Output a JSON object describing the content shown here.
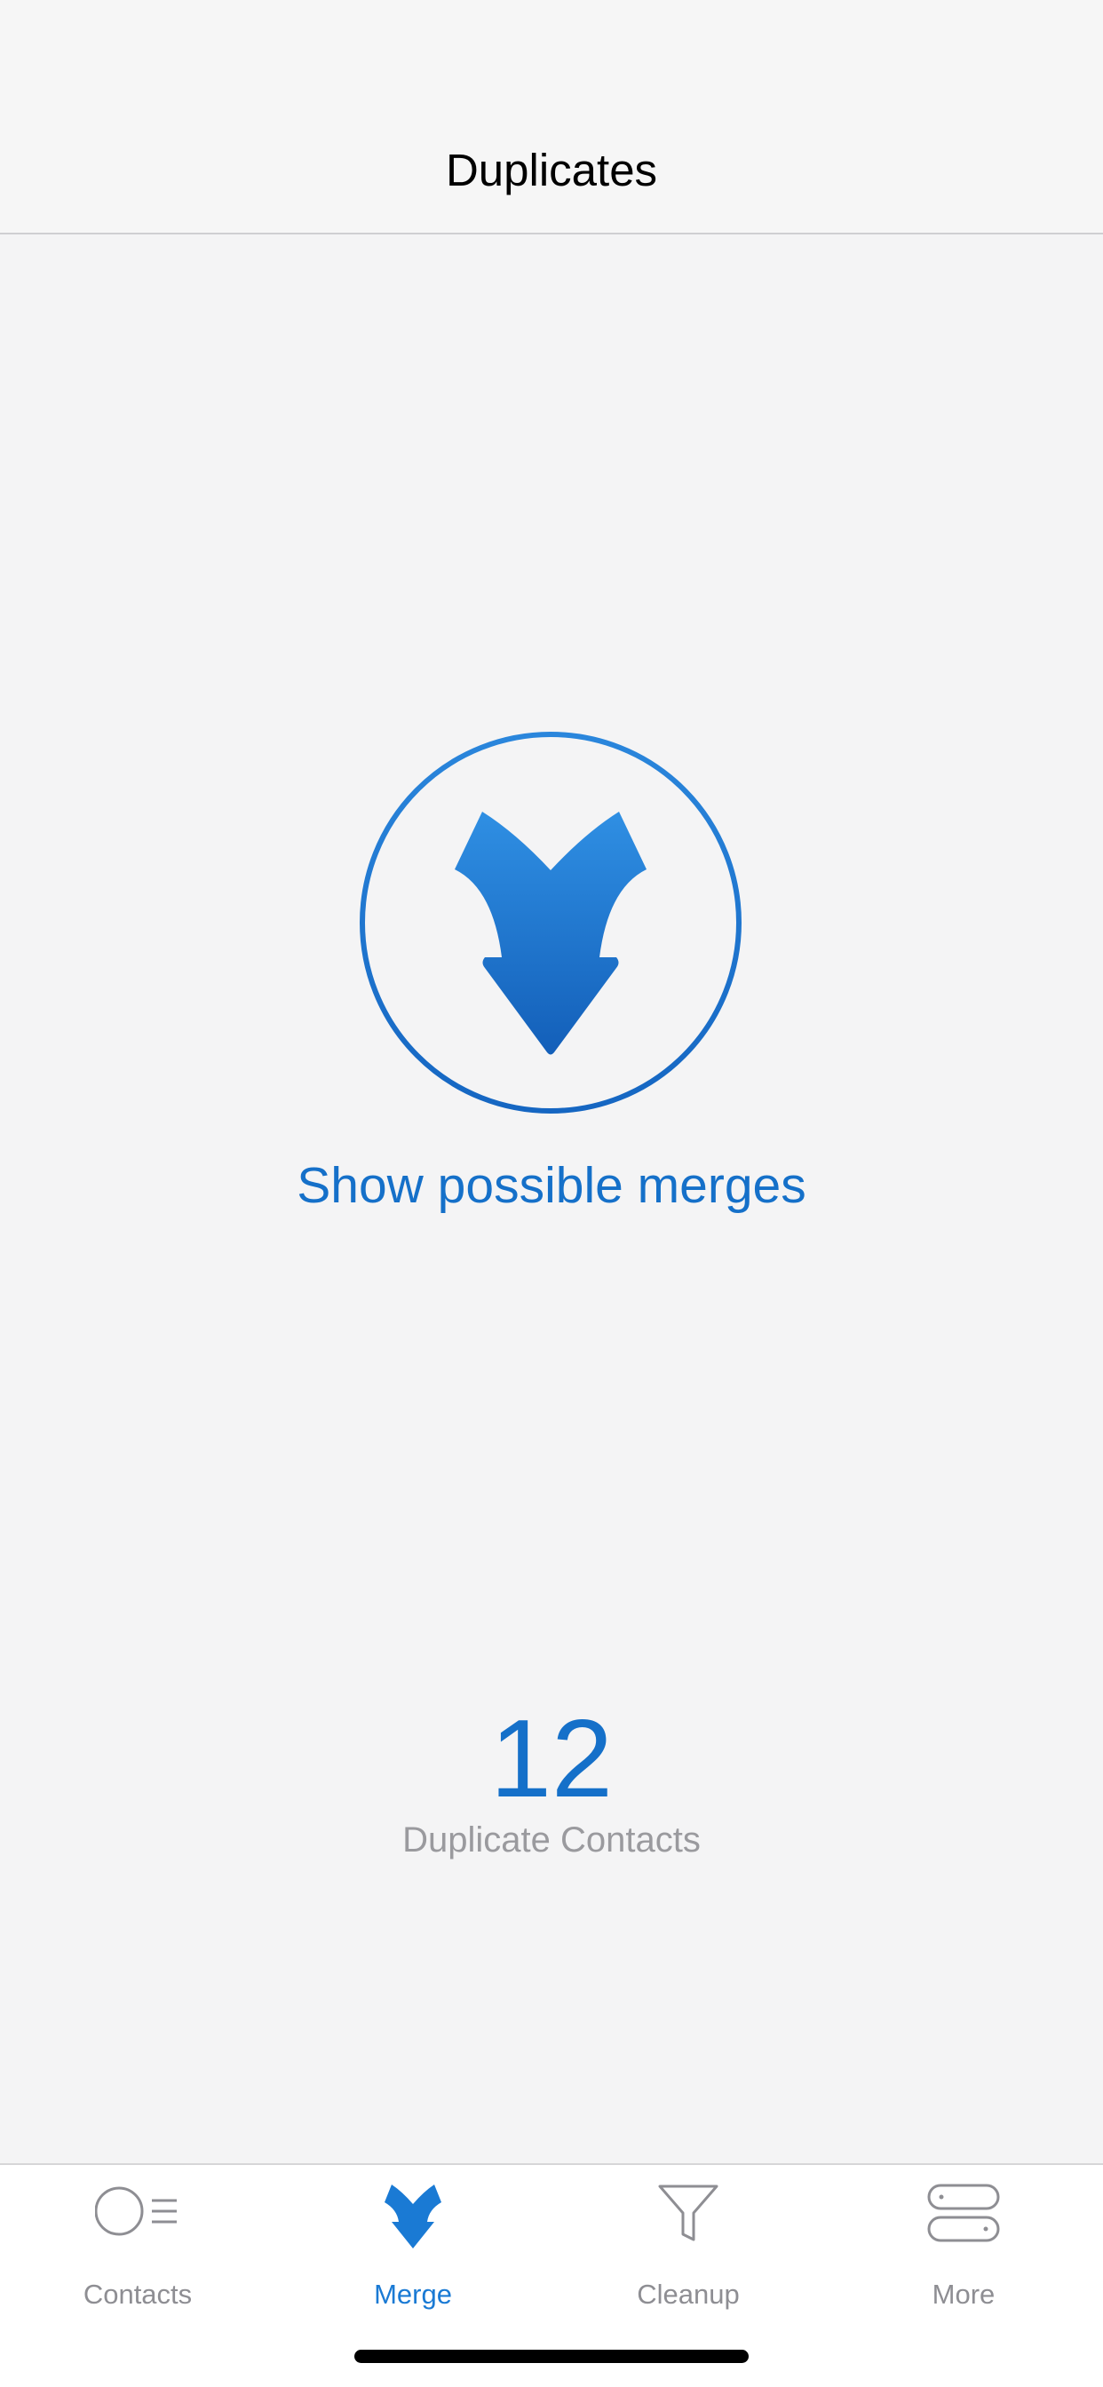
{
  "nav": {
    "title": "Duplicates"
  },
  "main": {
    "action_label": "Show possible merges",
    "duplicate_count": "12",
    "duplicate_label": "Duplicate Contacts",
    "merge_icon": "merge-arrows-icon"
  },
  "tabs": [
    {
      "label": "Contacts",
      "icon": "contacts-icon",
      "active": false
    },
    {
      "label": "Merge",
      "icon": "merge-icon",
      "active": true
    },
    {
      "label": "Cleanup",
      "icon": "funnel-icon",
      "active": false
    },
    {
      "label": "More",
      "icon": "more-icon",
      "active": false
    }
  ],
  "colors": {
    "accent": "#1570c9",
    "tab_active": "#1a7ad4",
    "tab_inactive": "#8e8e93",
    "background": "#f4f4f5"
  }
}
